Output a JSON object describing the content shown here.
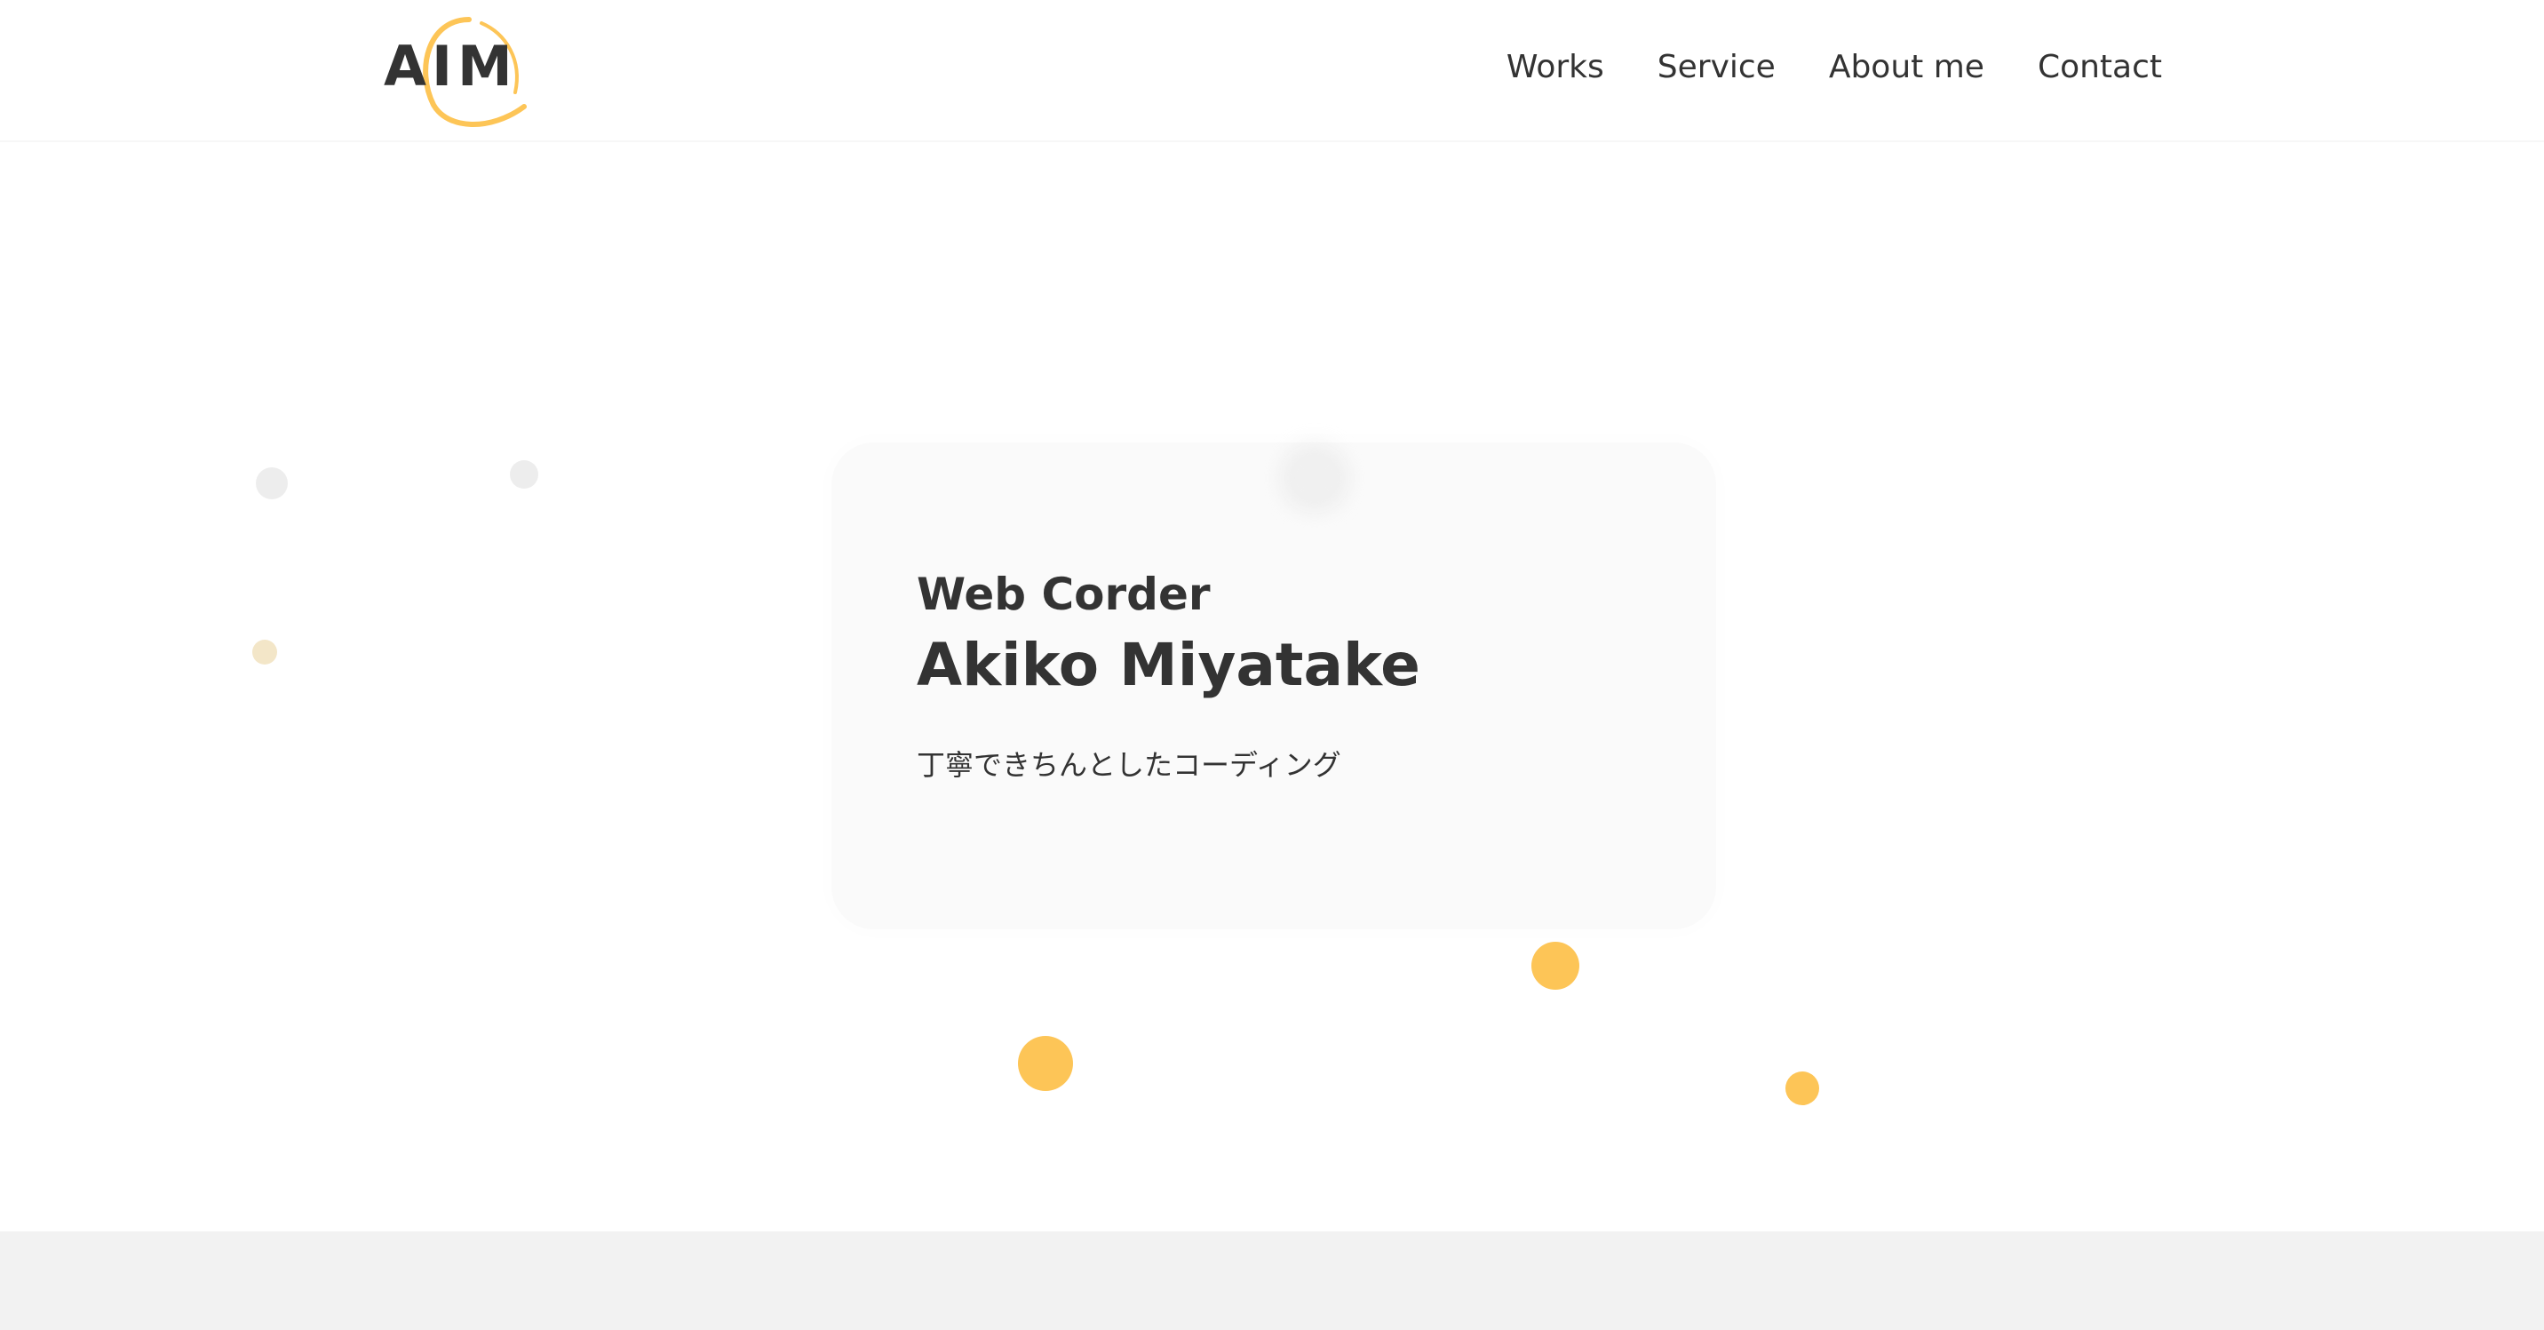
{
  "header": {
    "logo_text": "AIM",
    "nav": [
      "Works",
      "Service",
      "About me",
      "Contact"
    ]
  },
  "hero": {
    "subtitle": "Web Corder",
    "name": "Akiko Miyatake",
    "tagline": "丁寧できちんとしたコーディング"
  },
  "colors": {
    "text": "#333333",
    "accent": "#fdc557",
    "band": "#f2f2f2",
    "dot_gray": "#ededed",
    "dot_beige": "#f3e6c8"
  }
}
